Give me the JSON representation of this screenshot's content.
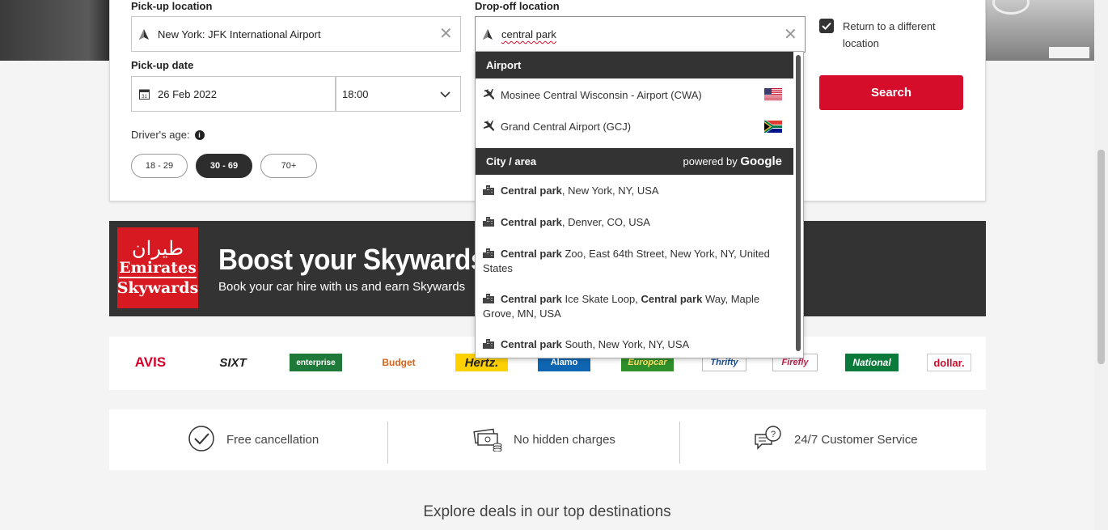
{
  "form": {
    "pickup_label": "Pick-up location",
    "pickup_value": "New York: JFK International Airport",
    "dropoff_label": "Drop-off location",
    "dropoff_value": "central park",
    "return_label": "Return to a different location",
    "pickup_date_label": "Pick-up date",
    "pickup_date": "26 Feb 2022",
    "pickup_time": "18:00",
    "search_button": "Search",
    "age_label": "Driver's age:",
    "info_icon_text": "i",
    "age_options": [
      "18 - 29",
      "30 - 69",
      "70+"
    ],
    "age_selected": "30 - 69"
  },
  "dropdown": {
    "airport_header": "Airport",
    "airports": [
      {
        "name": "Mosinee Central Wisconsin - Airport (CWA)",
        "flag": "us-flag-icon"
      },
      {
        "name": "Grand Central Airport (GCJ)",
        "flag": "za-flag-icon"
      }
    ],
    "city_header": "City / area",
    "powered_by": "powered by",
    "google": "Google",
    "cities": [
      {
        "bold": "Central park",
        "rest": ", New York, NY, USA"
      },
      {
        "bold": "Central park",
        "rest": ", Denver, CO, USA"
      },
      {
        "bold": "Central park",
        "rest": " Zoo, East 64th Street, New York, NY, United States"
      },
      {
        "bold": "Central park",
        "rest": " Ice Skate Loop, ",
        "bold2": "Central park",
        "rest2": " Way, Maple Grove, MN, USA"
      },
      {
        "bold": "Central park",
        "rest": " South, New York, NY, USA"
      }
    ]
  },
  "banner": {
    "logo_arabic": "طيران",
    "logo_line1": "Emirates",
    "logo_line2": "Skywards",
    "title": "Boost your Skywards",
    "subtitle": "Book your car hire with us and earn Skywards"
  },
  "brands": [
    "AVIS",
    "SIXT",
    "enterprise",
    "Budget",
    "Hertz.",
    "Alamo",
    "Europcar",
    "Thrifty",
    "Firefly",
    "National",
    "dollar."
  ],
  "features": [
    {
      "icon": "check-circle-icon",
      "label": "Free cancellation"
    },
    {
      "icon": "cash-icon",
      "label": "No hidden charges"
    },
    {
      "icon": "chat-question-icon",
      "label": "24/7 Customer Service"
    }
  ],
  "explore": "Explore deals in our top destinations",
  "colors": {
    "accent": "#d50d2b",
    "dark": "#333333"
  }
}
